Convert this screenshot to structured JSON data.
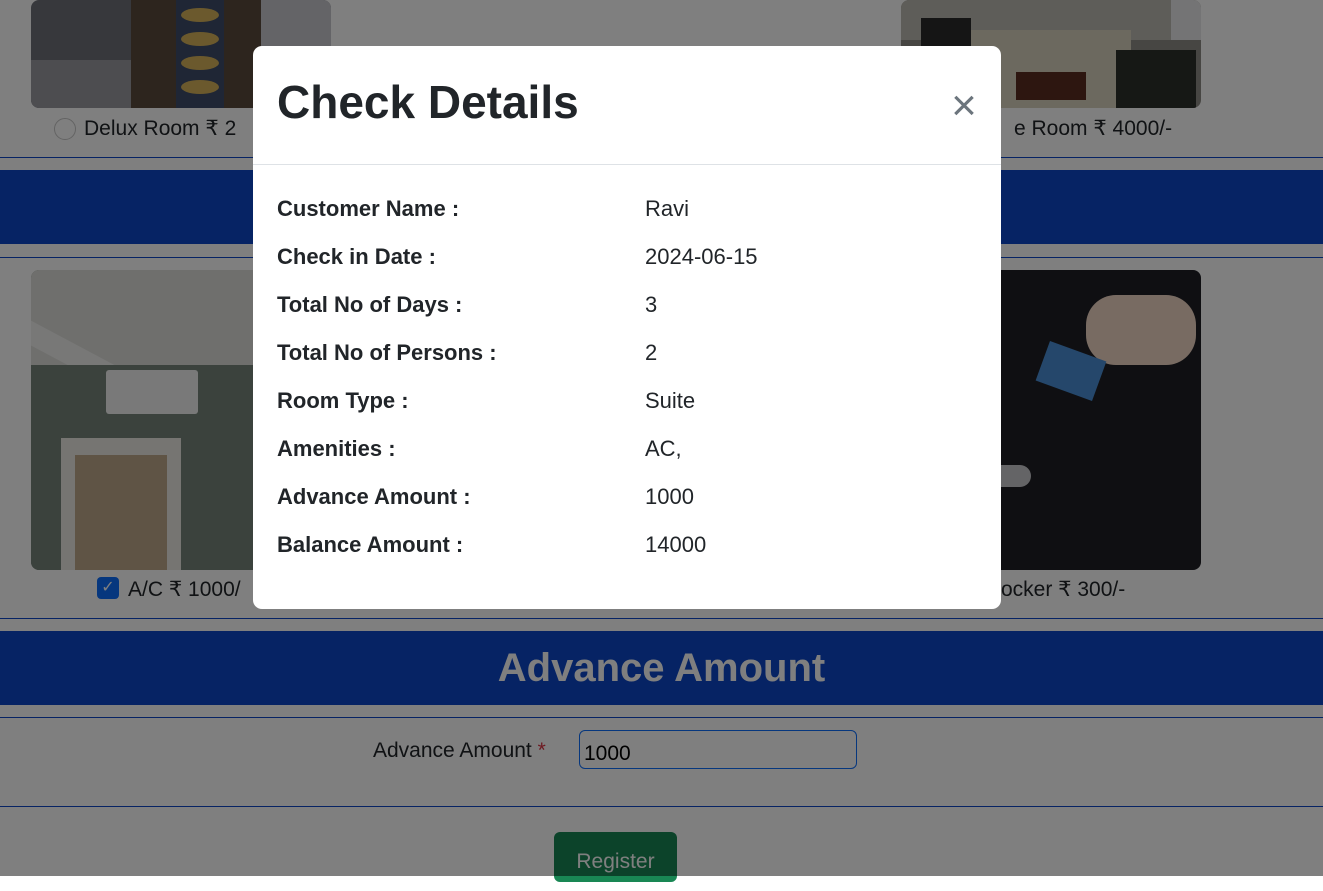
{
  "background_page": {
    "room_options": [
      {
        "label": "Delux Room ₹ 2",
        "selected": false
      },
      {
        "label": "e Room ₹ 4000/-",
        "selected": false
      }
    ],
    "amenity_options": [
      {
        "label": "A/C ₹ 1000/",
        "checked": true
      },
      {
        "label": "ocker ₹ 300/-",
        "checked": false
      }
    ],
    "advance_section_title": "Advance Amount",
    "advance_field": {
      "label": "Advance Amount",
      "required_mark": "*",
      "value": "1000"
    },
    "register_button": "Register"
  },
  "modal": {
    "title": "Check Details",
    "close_icon": "×",
    "rows": [
      {
        "label": "Customer Name :",
        "value": "Ravi"
      },
      {
        "label": "Check in Date :",
        "value": "2024-06-15"
      },
      {
        "label": "Total No of Days :",
        "value": "3"
      },
      {
        "label": "Total No of Persons :",
        "value": "2"
      },
      {
        "label": "Room Type :",
        "value": "Suite"
      },
      {
        "label": "Amenities :",
        "value": "AC,"
      },
      {
        "label": "Advance Amount :",
        "value": "1000"
      },
      {
        "label": "Balance Amount :",
        "value": "14000"
      }
    ]
  },
  "colors": {
    "band_blue": "#0d47c9",
    "checkbox_blue": "#0d6efd",
    "register_green": "#198754",
    "required_red": "#dc3545",
    "backdrop": "rgba(0,0,0,0.5)"
  }
}
